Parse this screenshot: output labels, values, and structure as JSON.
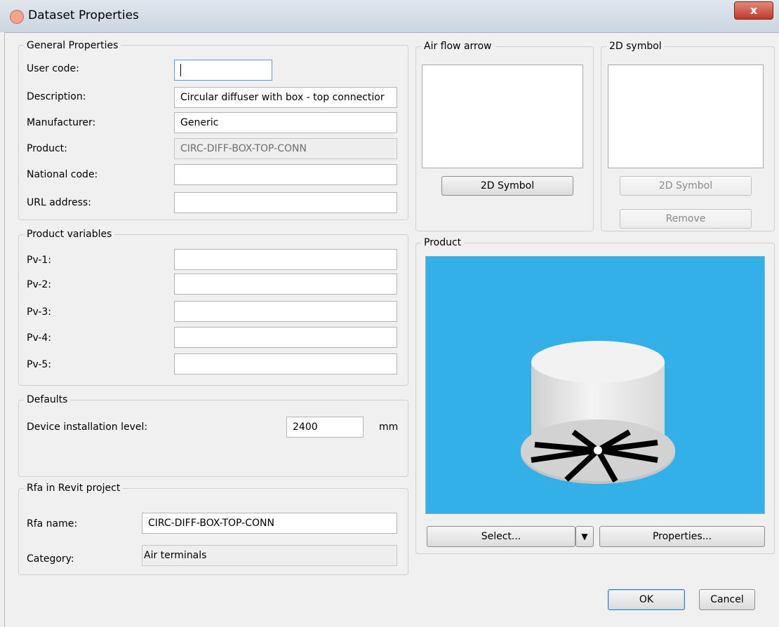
{
  "window": {
    "title": "Dataset Properties",
    "close_label": "x"
  },
  "general": {
    "legend": "General Properties",
    "fields": [
      {
        "label": "User code:",
        "value": ""
      },
      {
        "label": "Description:",
        "value": "Circular diffuser with box - top  connectior"
      },
      {
        "label": "Manufacturer:",
        "value": "Generic"
      },
      {
        "label": "Product:",
        "value": "CIRC-DIFF-BOX-TOP-CONN"
      },
      {
        "label": "National code:",
        "value": ""
      },
      {
        "label": "URL address:",
        "value": ""
      }
    ]
  },
  "product_variables": {
    "legend": "Product variables",
    "fields": [
      {
        "label": "Pv-1:",
        "value": ""
      },
      {
        "label": "Pv-2:",
        "value": ""
      },
      {
        "label": "Pv-3:",
        "value": ""
      },
      {
        "label": "Pv-4:",
        "value": ""
      },
      {
        "label": "Pv-5:",
        "value": ""
      }
    ]
  },
  "defaults": {
    "legend": "Defaults",
    "installation_label": "Device installation level:",
    "installation_value": "2400",
    "unit": "mm"
  },
  "rfa": {
    "legend": "Rfa in Revit project",
    "name_label": "Rfa name:",
    "name_value": "CIRC-DIFF-BOX-TOP-CONN",
    "category_label": "Category:",
    "category_value": "Air terminals"
  },
  "air_flow": {
    "legend": "Air flow arrow",
    "button": "2D Symbol"
  },
  "symbol_2d": {
    "legend": "2D symbol",
    "button": "2D Symbol",
    "remove": "Remove"
  },
  "product": {
    "legend": "Product",
    "select_button": "Select...",
    "properties_button": "Properties...",
    "viewport_color": "#33b0e8"
  },
  "footer": {
    "ok": "OK",
    "cancel": "Cancel"
  }
}
